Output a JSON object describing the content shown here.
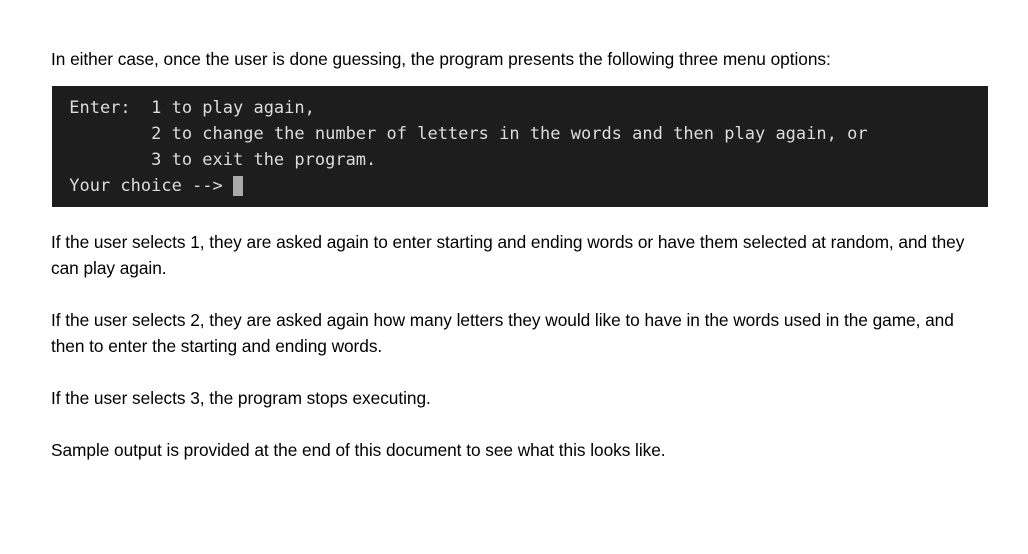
{
  "document": {
    "intro_paragraph": "In either case, once the user is done guessing, the program presents the following three menu options:",
    "terminal": {
      "lines": [
        " Enter:  1 to play again,",
        "         2 to change the number of letters in the words and then play again, or",
        "         3 to exit the program."
      ],
      "prompt": " Your choice -->",
      "cursor": "block-cursor",
      "background_color": "#1d1d1d",
      "text_color": "#dcdcdc",
      "cursor_color": "#aaaaaa"
    },
    "paragraphs": [
      "If the user selects 1, they are asked again to enter starting and ending words or have them selected at random, and they can play again.",
      "If the user selects 2, they are asked again how many letters they would like to have in the words used in the game, and then to enter the starting and ending words.",
      "If the user selects 3, the program stops executing.",
      "Sample output is provided at the end of this document to see what this looks like."
    ]
  }
}
